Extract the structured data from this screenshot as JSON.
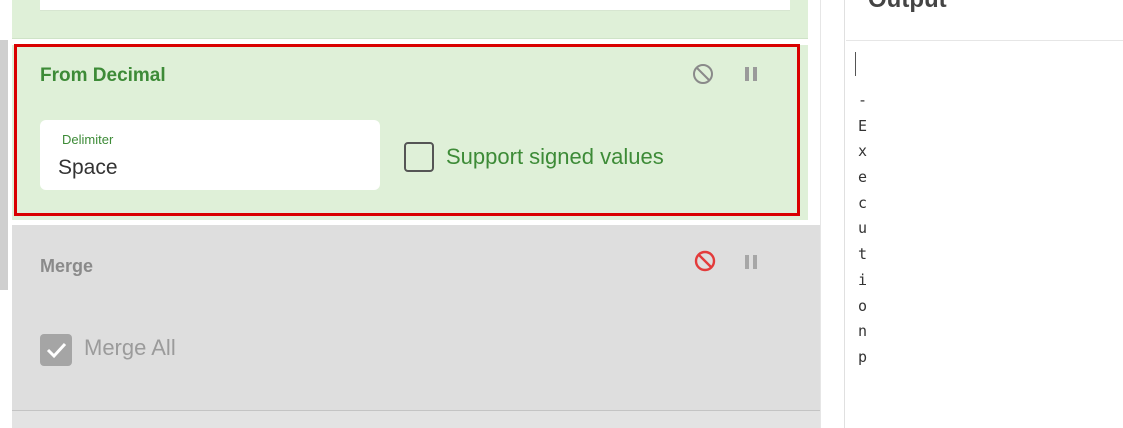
{
  "recipe": {
    "from_decimal": {
      "title": "From Decimal",
      "delimiter_label": "Delimiter",
      "delimiter_value": "Space",
      "signed_label": "Support signed values",
      "signed_checked": false,
      "disable_icon": "disable-icon",
      "pause_icon": "pause-icon",
      "highlighted": true
    },
    "merge": {
      "title": "Merge",
      "merge_all_label": "Merge All",
      "merge_all_checked": true,
      "disable_icon": "disable-icon",
      "pause_icon": "pause-icon"
    }
  },
  "output": {
    "title": "Output",
    "text_chars": [
      "-",
      "E",
      "x",
      "e",
      "c",
      "u",
      "t",
      "i",
      "o",
      "n",
      "p"
    ]
  },
  "colors": {
    "op_enabled_bg": "#dff0d8",
    "op_disabled_bg": "#dedede",
    "accent_green": "#3d8b37",
    "highlight_red": "#d90000",
    "disable_active_red": "#e33b3b"
  }
}
